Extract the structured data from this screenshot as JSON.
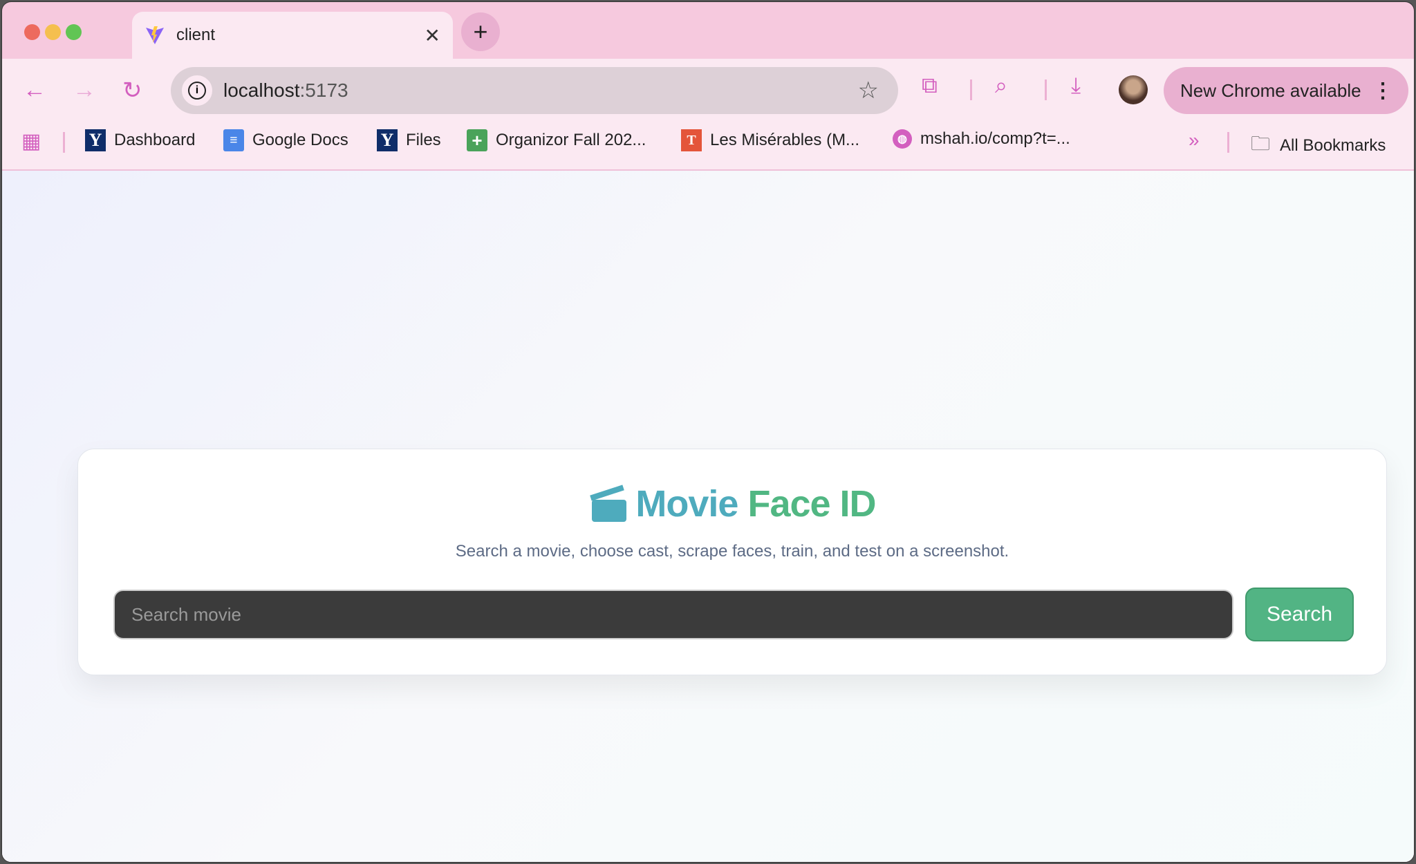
{
  "browser": {
    "tab_title": "client",
    "url_host": "localhost",
    "url_port": ":5173",
    "update_label": "New Chrome available",
    "bookmarks": [
      {
        "label": "Dashboard",
        "icon": "yale-y-icon"
      },
      {
        "label": "Google Docs",
        "icon": "google-docs-icon"
      },
      {
        "label": "Files",
        "icon": "yale-y-icon"
      },
      {
        "label": "Organizor Fall 202...",
        "icon": "google-sheets-icon"
      },
      {
        "label": "Les Misérables (M...",
        "icon": "document-icon"
      },
      {
        "label": "mshah.io/comp?t=...",
        "icon": "globe-icon"
      }
    ],
    "all_bookmarks": "All Bookmarks"
  },
  "app": {
    "title_part1": "Movie",
    "title_part2": "Face ID",
    "subtitle": "Search a movie, choose cast, scrape faces, train, and test on a screenshot.",
    "search_placeholder": "Search movie",
    "search_button": "Search",
    "colors": {
      "teal": "#4eabbd",
      "green": "#51b783",
      "input_bg": "#3b3b3b"
    }
  }
}
